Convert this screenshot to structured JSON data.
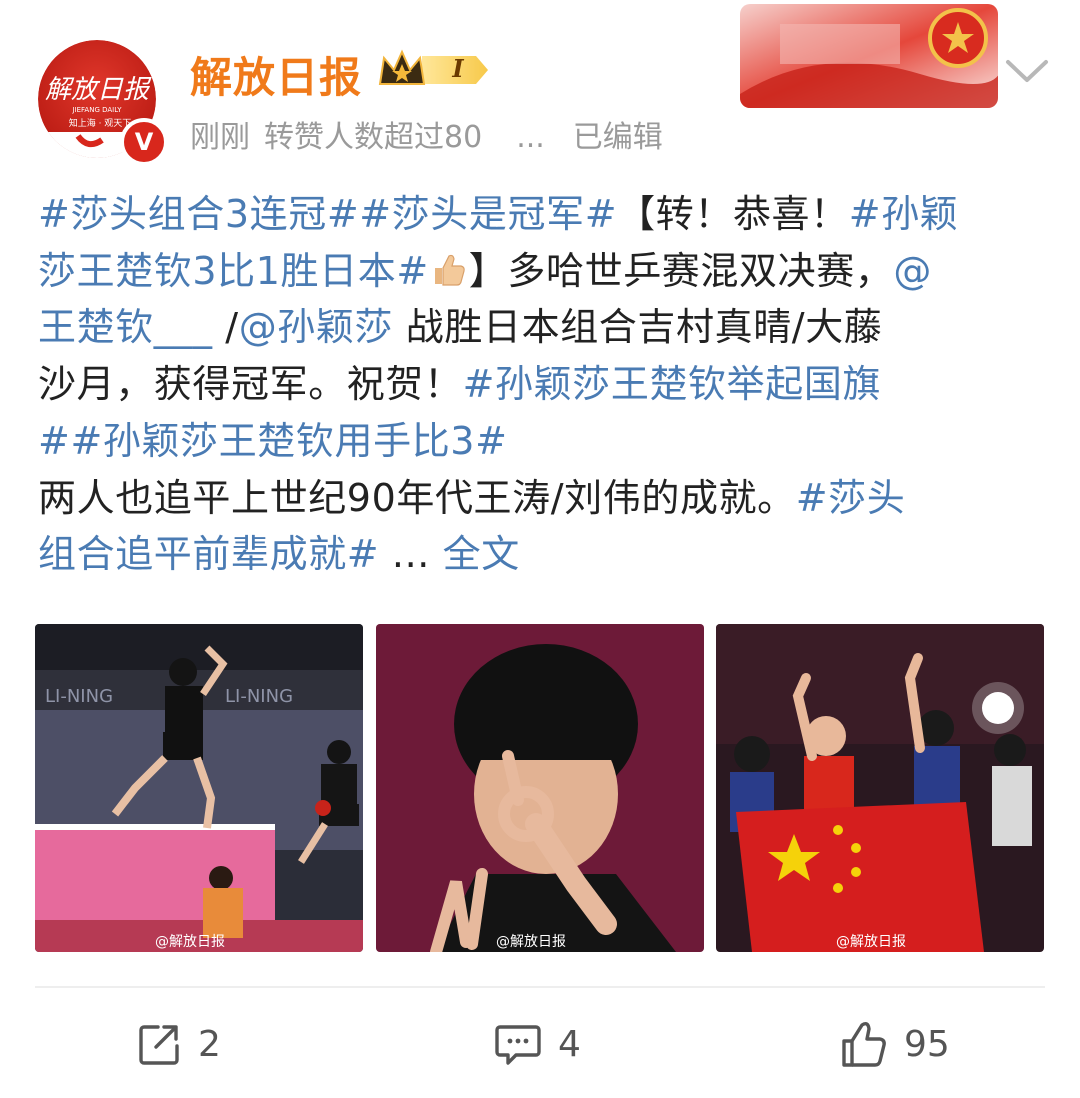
{
  "header": {
    "account_name": "解放日报",
    "vip_level": "I",
    "meta": {
      "time": "刚刚",
      "status": "转赞人数超过80",
      "dots": "...",
      "edited": "已编辑"
    },
    "avatar_logo_text": "解放日报",
    "avatar_sub_text": "JIEFANG DAILY",
    "avatar_slogan": "知上海 · 观天下",
    "verify_label": "V"
  },
  "post": {
    "line1": {
      "tag1": "#莎头组合3连冠#",
      "tag2": "#莎头是冠军#",
      "text": "【转！恭喜！",
      "tag3_start": "#孙颖"
    },
    "line2": {
      "tag3_end": "莎王楚钦3比1胜日本#",
      "text": "】多哈世乒赛混双决赛，",
      "mention_start": "@"
    },
    "line3": {
      "mention1": "王楚钦___",
      "sep": " /",
      "mention2": "@孙颖莎",
      "text": " 战胜日本组合吉村真晴/大藤"
    },
    "line4": {
      "text": "沙月，获得冠军。祝贺！",
      "tag4": "#孙颖莎王楚钦举起国旗"
    },
    "line5": {
      "tag4_end": "#",
      "tag5": "#孙颖莎王楚钦用手比3#"
    },
    "line6": {
      "text": "两人也追平上世纪90年代王涛/刘伟的成就。",
      "tag6_start": "#莎头"
    },
    "line7": {
      "tag6_end": "组合追平前辈成就#",
      "ellipsis": " ... ",
      "more": "全文"
    }
  },
  "images": [
    {
      "watermark": "@解放日报"
    },
    {
      "watermark": "@解放日报"
    },
    {
      "watermark": "@解放日报"
    }
  ],
  "actions": {
    "repost_count": "2",
    "comment_count": "4",
    "like_count": "95"
  },
  "colors": {
    "name_orange": "#f07a1a",
    "link_blue": "#4a7bb3",
    "meta_gray": "#9a9a9a",
    "brand_red": "#d8271c"
  }
}
